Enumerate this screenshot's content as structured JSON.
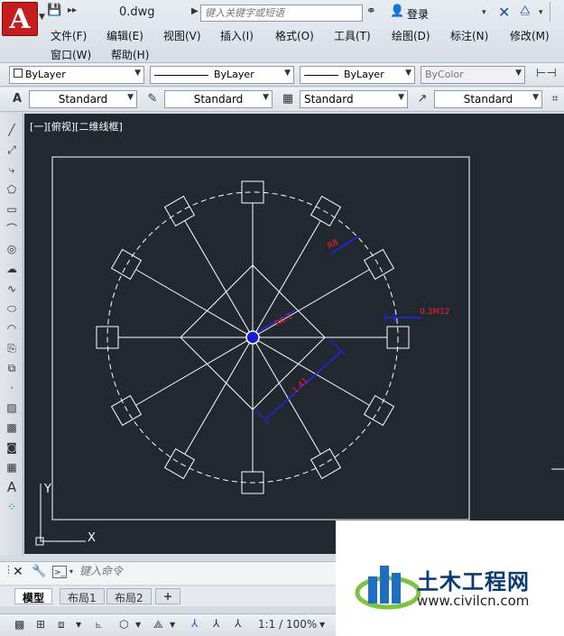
{
  "app": {
    "logo_letter": "A",
    "doc_title": "0.dwg"
  },
  "search": {
    "placeholder": "键入关键字或短语"
  },
  "user": {
    "login_label": "登录"
  },
  "menu": {
    "items": [
      "文件(F)",
      "编辑(E)",
      "视图(V)",
      "插入(I)",
      "格式(O)",
      "工具(T)",
      "绘图(D)",
      "标注(N)",
      "修改(M)"
    ],
    "items_row2": [
      "窗口(W)",
      "帮助(H)"
    ]
  },
  "properties": {
    "layer": "ByLayer",
    "linetype": "ByLayer",
    "lineweight": "ByLayer",
    "color": "ByColor"
  },
  "styles": {
    "text_style": "Standard",
    "dim_style": "Standard",
    "table_style": "Standard",
    "mleader_style": "Standard"
  },
  "viewport": {
    "label": "[一][俯视][二维线框]"
  },
  "drawing": {
    "dimensions": [
      "R8",
      "0.3M12",
      "R0.1",
      "1.41"
    ],
    "ucs_x": "X",
    "ucs_y": "Y"
  },
  "command": {
    "placeholder": "键入命令"
  },
  "layout_tabs": [
    "模型",
    "布局1",
    "布局2"
  ],
  "status": {
    "scale": "1:1 / 100%"
  },
  "watermark": {
    "title": "土木工程网",
    "url": "www.civilcn.com"
  },
  "colors": {
    "canvas_bg": "#212830",
    "line_white": "#ffffff",
    "dim_blue": "#2222ff",
    "dim_red": "#ff2020",
    "logo_red": "#c51d1d"
  }
}
